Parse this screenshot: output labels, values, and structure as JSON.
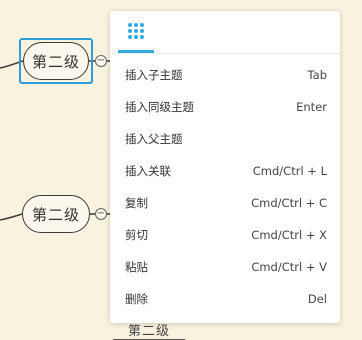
{
  "nodes": {
    "top": "第二级",
    "middle": "第二级",
    "bottom_partial": "第二级"
  },
  "collapse_symbol": "−",
  "colors": {
    "background": "#f9f2de",
    "selection": "#2f9bd8",
    "accent": "#33a7e0"
  },
  "menu": {
    "tab_icon": "grid-dots-icon",
    "items": [
      {
        "label": "插入子主题",
        "shortcut": "Tab"
      },
      {
        "label": "插入同级主题",
        "shortcut": "Enter"
      },
      {
        "label": "插入父主题",
        "shortcut": ""
      },
      {
        "label": "插入关联",
        "shortcut": "Cmd/Ctrl + L"
      },
      {
        "label": "复制",
        "shortcut": "Cmd/Ctrl + C"
      },
      {
        "label": "剪切",
        "shortcut": "Cmd/Ctrl + X"
      },
      {
        "label": "粘贴",
        "shortcut": "Cmd/Ctrl + V"
      },
      {
        "label": "删除",
        "shortcut": "Del"
      }
    ]
  }
}
